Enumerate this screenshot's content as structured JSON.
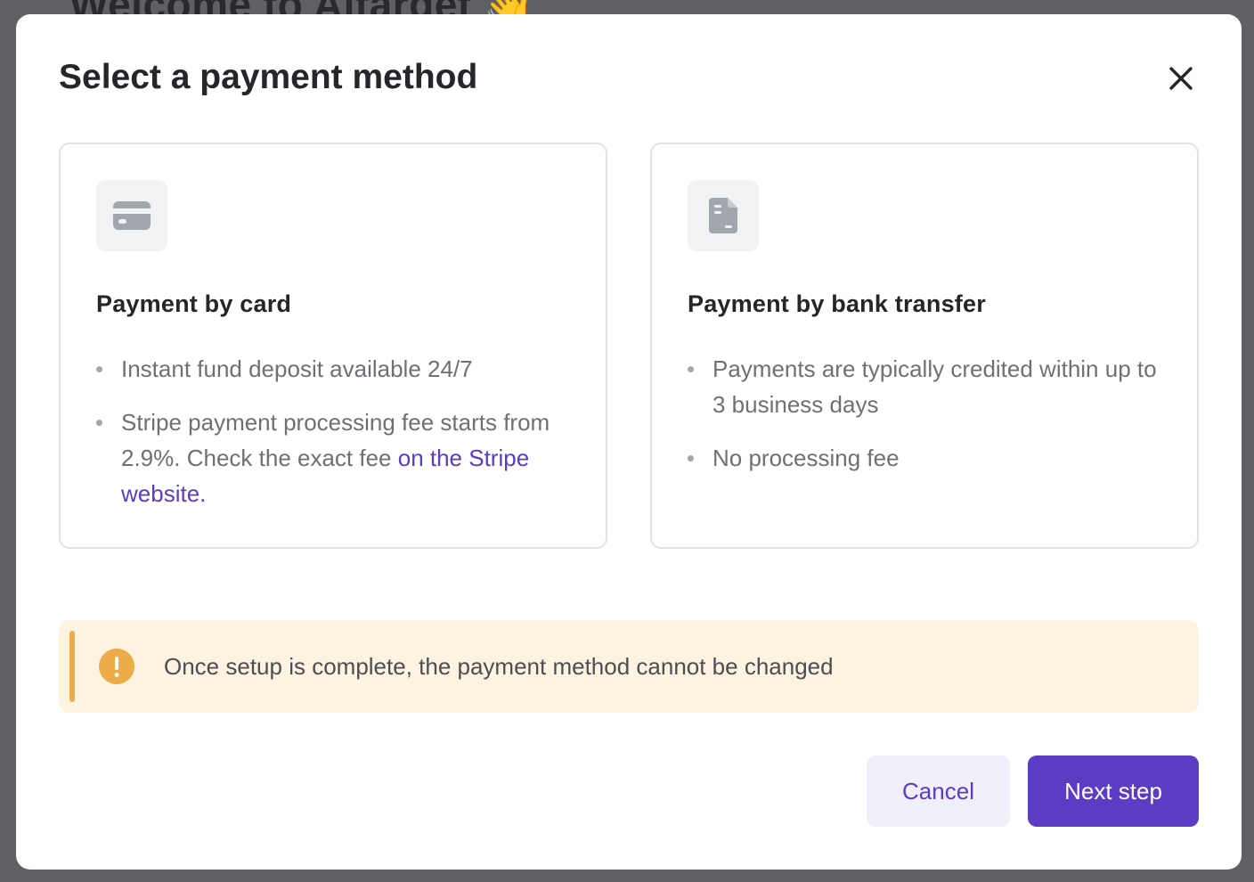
{
  "background": {
    "page_title": "Welcome to Aitarget 👋"
  },
  "modal": {
    "title": "Select a payment method",
    "close_icon": "close-icon"
  },
  "cards": [
    {
      "icon": "credit-card-icon",
      "title": "Payment by card",
      "items": [
        {
          "text": "Instant fund deposit available 24/7",
          "link": ""
        },
        {
          "text": "Stripe payment processing fee starts from 2.9%. Check the exact fee ",
          "link": "on the Stripe website."
        }
      ]
    },
    {
      "icon": "document-icon",
      "title": "Payment by bank transfer",
      "items": [
        {
          "text": "Payments are typically credited within up to 3 business days",
          "link": ""
        },
        {
          "text": "No processing fee",
          "link": ""
        }
      ]
    }
  ],
  "warning": {
    "icon": "exclamation-circle-icon",
    "text": "Once setup is complete, the payment method cannot be changed"
  },
  "actions": {
    "cancel_label": "Cancel",
    "next_label": "Next step"
  },
  "colors": {
    "accent": "#5b3cc4",
    "warning_bg": "#fdf3e1",
    "warning_accent": "#ecac47",
    "overlay": "#5f6063"
  }
}
